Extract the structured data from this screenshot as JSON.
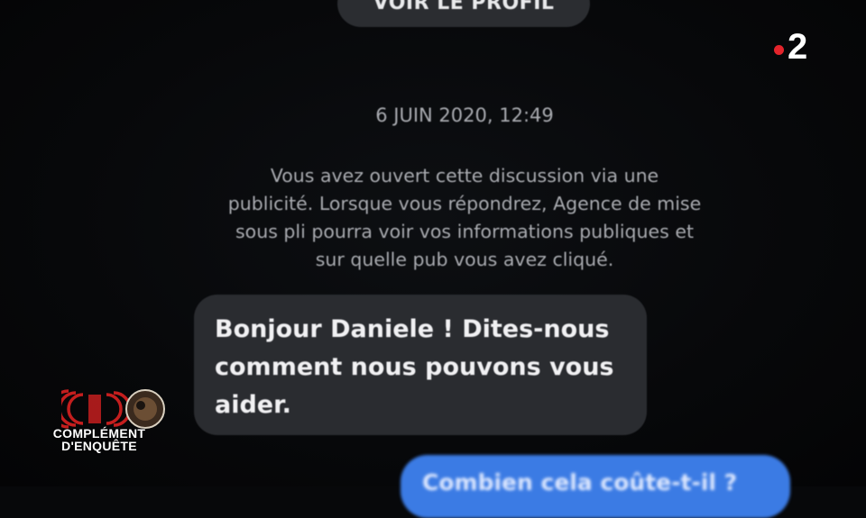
{
  "conversation": {
    "profile_button": "VOIR LE PROFIL",
    "timestamp": "6 JUIN 2020, 12:49",
    "notice_lines": [
      "Vous avez ouvert cette discussion via une",
      "publicité. Lorsque vous répondrez, Agence de mise",
      "sous pli pourra voir vos informations publiques et",
      "sur quelle pub vous avez cliqué."
    ],
    "incoming_message_lines": [
      "Bonjour Daniele ! Dites-nous",
      "comment nous pouvons vous",
      "aider."
    ],
    "outgoing_message_partial": "Combien cela coûte-t-il ?"
  },
  "broadcast": {
    "channel_number": "2",
    "show_title_line1": "COMPLÉMENT",
    "show_title_line2": "D'ENQUÊTE"
  },
  "colors": {
    "background": "#07080a",
    "incoming_bubble": "#2a2c30",
    "outgoing_bubble": "#3b7be4",
    "channel_dot": "#e3242b",
    "logo_accent": "#c41e1e"
  },
  "icons": {
    "channel_logo": "france2-logo",
    "show_logo": "complement-enquete-logo"
  }
}
